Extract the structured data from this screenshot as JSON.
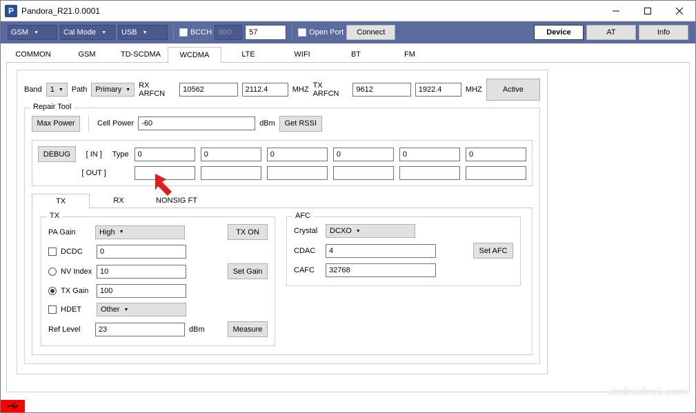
{
  "title": "Pandora_R21.0.0001",
  "toolbar": {
    "select1": "GSM",
    "select2": "Cal Mode",
    "select3": "USB",
    "bcch_label": "BCCH",
    "bcch_val": "900",
    "bcch_val2": "57",
    "openport_label": "Open Port",
    "connect": "Connect",
    "device": "Device",
    "at": "AT",
    "info": "Info"
  },
  "tabs": [
    "COMMON",
    "GSM",
    "TD-SCDMA",
    "WCDMA",
    "LTE",
    "WIFI",
    "BT",
    "FM"
  ],
  "active_tab": "WCDMA",
  "bandrow": {
    "band_label": "Band",
    "band_val": "1",
    "path_label": "Path",
    "path_val": "Primary",
    "rx_arfcn_label": "RX ARFCN",
    "rx_arfcn_val": "10562",
    "rx_arfcn_mhz": "2112.4",
    "mhz1": "MHZ",
    "tx_arfcn_label": "TX ARFCN",
    "tx_arfcn_val": "9612",
    "tx_arfcn_mhz": "1922.4",
    "mhz2": "MHZ",
    "active": "Active"
  },
  "repair": {
    "legend": "Repair Tool",
    "max_power": "Max Power",
    "cell_power_label": "Cell Power",
    "cell_power_val": "-60",
    "dbm": "dBm",
    "get_rssi": "Get RSSI",
    "debug": "DEBUG",
    "in_label": "[ IN ]",
    "out_label": "[ OUT ]",
    "type_label": "Type",
    "in_vals": [
      "0",
      "0",
      "0",
      "0",
      "0",
      "0"
    ],
    "out_vals": [
      "",
      "",
      "",
      "",
      "",
      ""
    ]
  },
  "subtabs": [
    "TX",
    "RX",
    "NONSIG FT"
  ],
  "active_subtab": "TX",
  "tx_panel": {
    "legend": "TX",
    "pa_gain_label": "PA Gain",
    "pa_gain_val": "High",
    "tx_on": "TX ON",
    "dcdc_label": "DCDC",
    "dcdc_val": "0",
    "nvindex_label": "NV Index",
    "nvindex_val": "10",
    "set_gain": "Set Gain",
    "txgain_label": "TX Gain",
    "txgain_val": "100",
    "hdet_label": "HDET",
    "hdet_val": "Other",
    "reflevel_label": "Ref Level",
    "reflevel_val": "23",
    "dbm": "dBm",
    "measure": "Measure"
  },
  "afc_panel": {
    "legend": "AFC",
    "crystal_label": "Crystal",
    "crystal_val": "DCXO",
    "cdac_label": "CDAC",
    "cdac_val": "4",
    "set_afc": "Set AFC",
    "cafc_label": "CAFC",
    "cafc_val": "32768"
  },
  "watermark": "androidmtk.com"
}
